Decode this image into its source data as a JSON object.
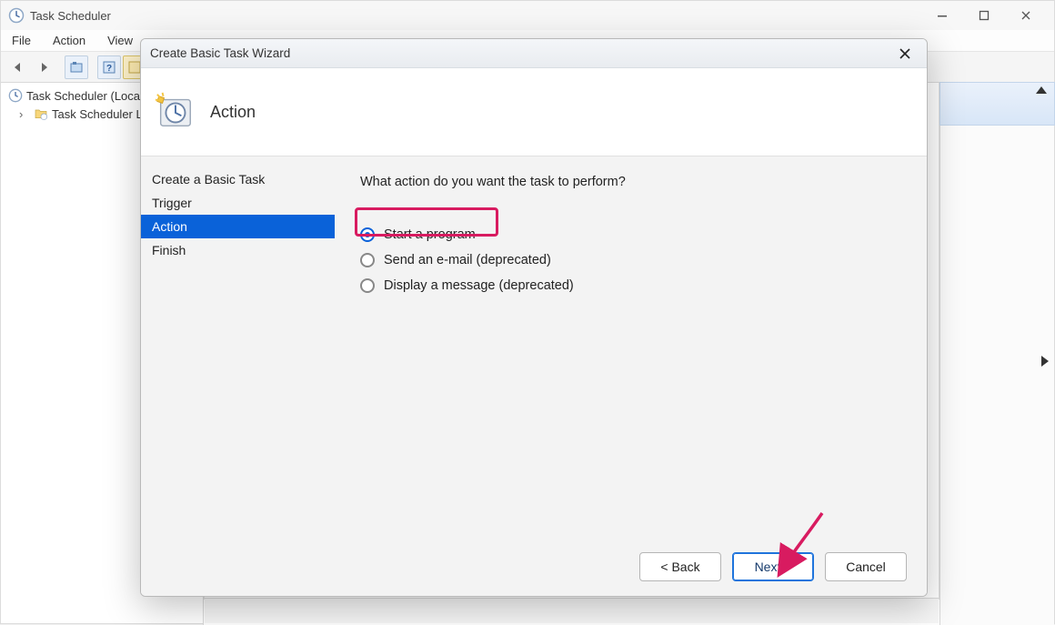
{
  "mainWindow": {
    "title": "Task Scheduler",
    "menu": {
      "file": "File",
      "action": "Action",
      "view": "View"
    },
    "tree": {
      "root": "Task Scheduler (Local)",
      "child": "Task Scheduler Library"
    }
  },
  "dialog": {
    "title": "Create Basic Task Wizard",
    "heading": "Action",
    "nav": {
      "createBasicTask": "Create a Basic Task",
      "trigger": "Trigger",
      "action": "Action",
      "finish": "Finish"
    },
    "question": "What action do you want the task to perform?",
    "options": {
      "startProgram": "Start a program",
      "sendEmail": "Send an e-mail (deprecated)",
      "displayMessage": "Display a message (deprecated)"
    },
    "buttons": {
      "back": "< Back",
      "next": "Next >",
      "cancel": "Cancel"
    }
  }
}
